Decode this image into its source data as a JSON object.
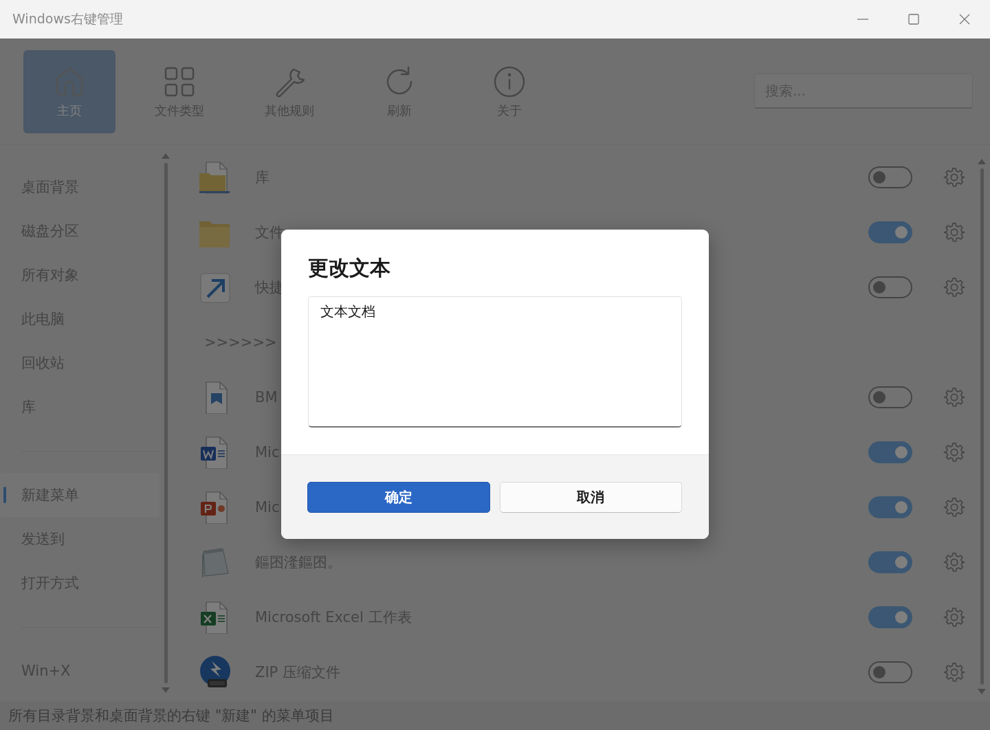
{
  "window": {
    "title": "Windows右键管理"
  },
  "toolbar": [
    {
      "label": "主页",
      "selected": true
    },
    {
      "label": "文件类型",
      "selected": false
    },
    {
      "label": "其他规则",
      "selected": false
    },
    {
      "label": "刷新",
      "selected": false
    },
    {
      "label": "关于",
      "selected": false
    }
  ],
  "search": {
    "placeholder": "搜索..."
  },
  "sidebar": {
    "items": [
      {
        "kind": "item",
        "label": "桌面背景",
        "selected": false
      },
      {
        "kind": "item",
        "label": "磁盘分区",
        "selected": false
      },
      {
        "kind": "item",
        "label": "所有对象",
        "selected": false
      },
      {
        "kind": "item",
        "label": "此电脑",
        "selected": false
      },
      {
        "kind": "item",
        "label": "回收站",
        "selected": false
      },
      {
        "kind": "item",
        "label": "库",
        "selected": false
      },
      {
        "kind": "divider"
      },
      {
        "kind": "item",
        "label": "新建菜单",
        "selected": true
      },
      {
        "kind": "item",
        "label": "发送到",
        "selected": false
      },
      {
        "kind": "item",
        "label": "打开方式",
        "selected": false
      },
      {
        "kind": "divider"
      },
      {
        "kind": "item",
        "label": "Win+X",
        "selected": false
      }
    ]
  },
  "rows": [
    {
      "kind": "item",
      "label": "库",
      "on": false
    },
    {
      "kind": "item",
      "label": "文件",
      "on": true
    },
    {
      "kind": "item",
      "label": "快捷",
      "on": false
    },
    {
      "kind": "separator",
      "label": ">>>>>>"
    },
    {
      "kind": "item",
      "label": "BM",
      "on": false
    },
    {
      "kind": "item",
      "label": "Mic",
      "on": true
    },
    {
      "kind": "item",
      "label": "Mic",
      "on": true
    },
    {
      "kind": "item",
      "label": "鏂囨湰鏂囨。",
      "on": true
    },
    {
      "kind": "item",
      "label": "Microsoft Excel 工作表",
      "on": true
    },
    {
      "kind": "item",
      "label": "ZIP 压缩文件",
      "on": false
    }
  ],
  "status_bar": "所有目录背景和桌面背景的右键 \"新建\" 的菜单项目",
  "dialog": {
    "title": "更改文本",
    "value": "文本文档",
    "buttons": [
      {
        "label": "确定",
        "kind": "primary"
      },
      {
        "label": "取消",
        "kind": "secondary"
      }
    ]
  }
}
